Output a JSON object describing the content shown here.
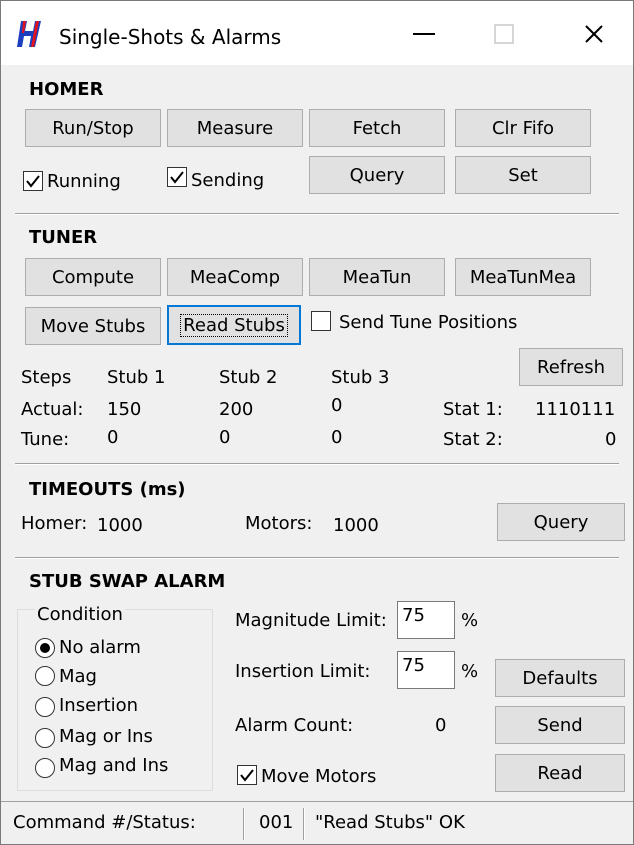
{
  "window": {
    "title": "Single-Shots & Alarms",
    "minimize_glyph": "—",
    "maximize_glyph": "☐",
    "close_glyph": "✕"
  },
  "homer": {
    "header": "HOMER",
    "run_stop_label": "Run/Stop",
    "measure_label": "Measure",
    "fetch_label": "Fetch",
    "clr_fifo_label": "Clr Fifo",
    "query_label": "Query",
    "set_label": "Set",
    "running_label": "Running",
    "running_checked": true,
    "sending_label": "Sending",
    "sending_checked": true
  },
  "tuner": {
    "header": "TUNER",
    "compute_label": "Compute",
    "meacomp_label": "MeaComp",
    "meatun_label": "MeaTun",
    "meatunmea_label": "MeaTunMea",
    "move_stubs_label": "Move Stubs",
    "read_stubs_label": "Read Stubs",
    "send_tune_label": "Send Tune Positions",
    "send_tune_checked": false,
    "refresh_label": "Refresh",
    "steps_label": "Steps",
    "stub1_label": "Stub 1",
    "stub2_label": "Stub 2",
    "stub3_label": "Stub 3",
    "actual_label": "Actual:",
    "actual": [
      "150",
      "200",
      "0"
    ],
    "tune_label": "Tune:",
    "tune": [
      "0",
      "0",
      "0"
    ],
    "stat1_label": "Stat 1:",
    "stat1_value": "1110111",
    "stat2_label": "Stat 2:",
    "stat2_value": "0"
  },
  "timeouts": {
    "header": "TIMEOUTS (ms)",
    "homer_label": "Homer:",
    "homer_value": "1000",
    "motors_label": "Motors:",
    "motors_value": "1000",
    "query_label": "Query"
  },
  "alarm": {
    "header": "STUB SWAP ALARM",
    "condition_label": "Condition",
    "options": [
      "No alarm",
      "Mag",
      "Insertion",
      "Mag or Ins",
      "Mag and Ins"
    ],
    "selected_option": "No alarm",
    "magnitude_label": "Magnitude Limit:",
    "magnitude_value": "75",
    "insertion_label": "Insertion Limit:",
    "insertion_value": "75",
    "percent": "%",
    "alarm_count_label": "Alarm Count:",
    "alarm_count_value": "0",
    "defaults_label": "Defaults",
    "send_label": "Send",
    "read_label": "Read",
    "move_motors_label": "Move Motors",
    "move_motors_checked": true
  },
  "status": {
    "label": "Command #/Status:",
    "number": "001",
    "message": "\"Read Stubs\" OK"
  },
  "colors": {
    "icon_red": "#e0141e",
    "icon_blue": "#1d3fbf",
    "focus_blue": "#0078d7"
  }
}
